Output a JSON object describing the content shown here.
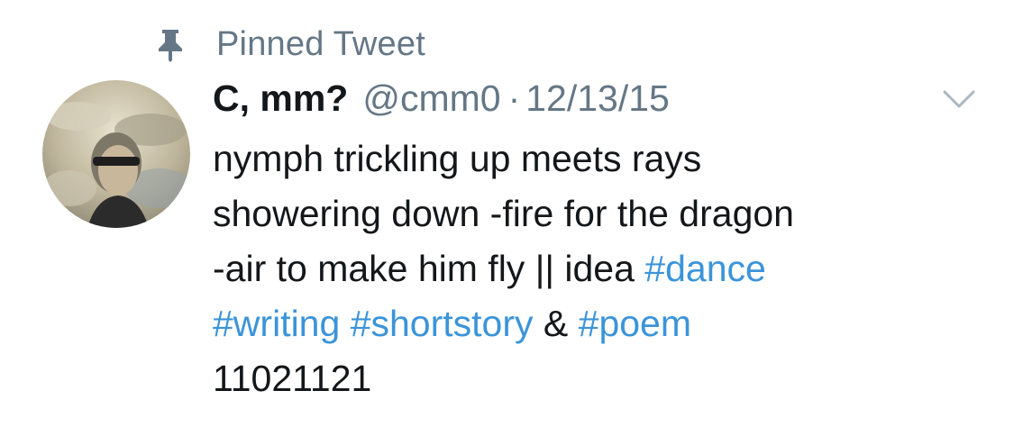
{
  "pinned": {
    "label": "Pinned Tweet",
    "icon": "pin-icon"
  },
  "tweet": {
    "author_name": "C, mm?",
    "handle": "@cmm0",
    "separator": "·",
    "date": "12/13/15",
    "avatar_icon": "avatar",
    "menu_icon": "chevron-down-icon",
    "body": {
      "line1": "nymph trickling up meets rays",
      "line2": "showering down -fire for the dragon",
      "line3_text": "-air to make him fly || idea ",
      "hashtag_dance": "#dance",
      "hashtag_writing": "#writing",
      "space1": " ",
      "hashtag_shortstory": "#shortstory",
      "amp": " & ",
      "hashtag_poem": "#poem",
      "line5": "11021121"
    }
  },
  "colors": {
    "text": "#14171a",
    "secondary": "#657786",
    "link": "#3b94d9",
    "background": "#ffffff"
  }
}
